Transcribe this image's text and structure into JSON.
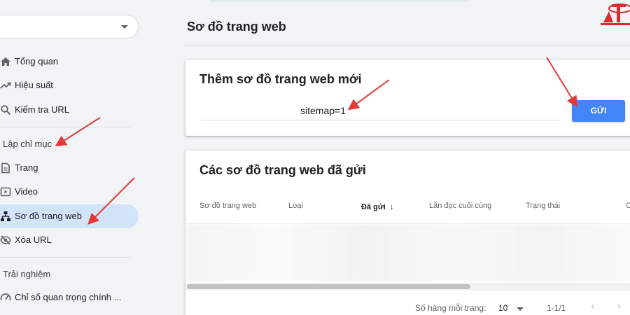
{
  "sidebar": {
    "items": [
      {
        "label": "Tổng quan",
        "icon": "home-icon"
      },
      {
        "label": "Hiệu suất",
        "icon": "trending-up-icon"
      },
      {
        "label": "Kiểm tra URL",
        "icon": "search-icon"
      },
      {
        "label": "Trang",
        "icon": "page-icon"
      },
      {
        "label": "Video",
        "icon": "video-icon"
      },
      {
        "label": "Sơ đồ trang web",
        "icon": "sitemap-icon"
      },
      {
        "label": "Xóa URL",
        "icon": "visibility-off-icon"
      },
      {
        "label": "Chỉ số quan trọng chính ...",
        "icon": "speed-icon"
      }
    ],
    "sections": [
      "Lập chỉ mục",
      "Trải nghiệm"
    ],
    "active_item": "Sơ đồ trang web"
  },
  "main": {
    "title": "Sơ đồ trang web",
    "add_card": {
      "title": "Thêm sơ đồ trang web mới",
      "input_value": "sitemap=1",
      "submit_label": "GỬI"
    },
    "submitted_card": {
      "title": "Các sơ đồ trang web đã gửi",
      "columns": [
        "Sơ đồ trang web",
        "Loại",
        "Đã gửi",
        "Lần đọc cuối cùng",
        "Trạng thái",
        "C"
      ],
      "sorted_column": "Đã gửi",
      "sort_arrow": "↓",
      "pagination": {
        "rows_label": "Số hàng mỗi trang:",
        "rows_value": "10",
        "range": "1-1/1",
        "prev": "‹",
        "next": "›"
      }
    }
  },
  "colors": {
    "accent": "#4285f4",
    "active_nav": "#d2e3fc",
    "annotation_arrow": "#e53935",
    "background": "#f1f3f4"
  }
}
